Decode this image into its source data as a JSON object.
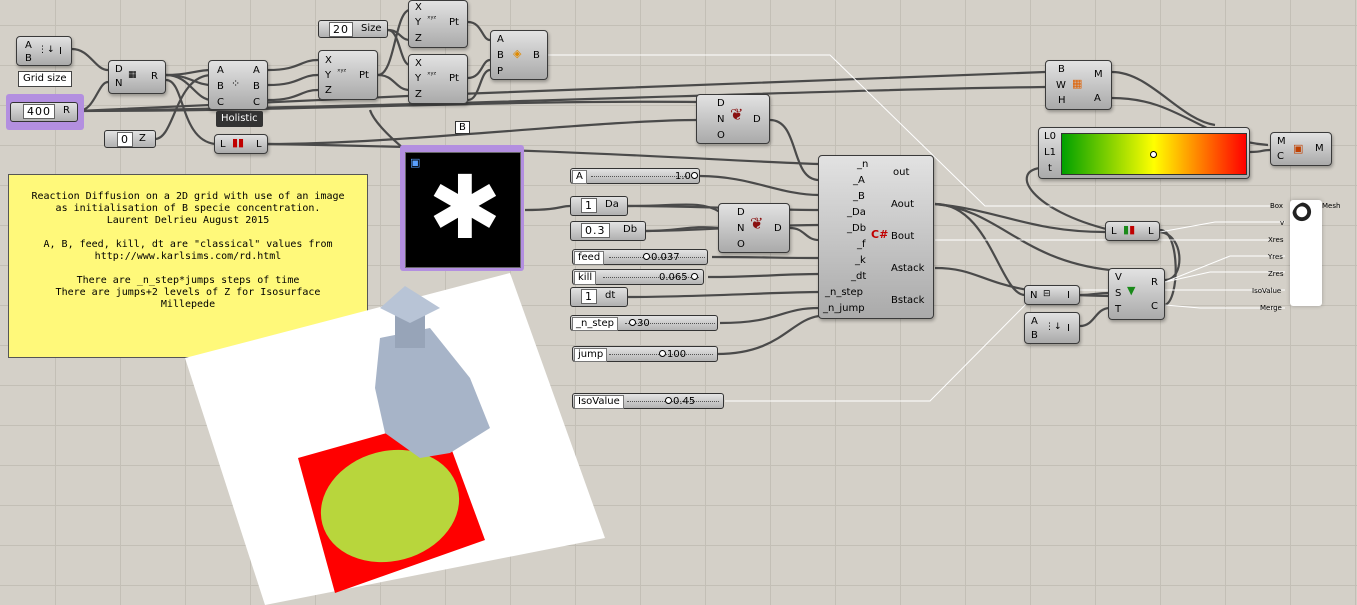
{
  "canvas": {
    "background": "#d4d0c8"
  },
  "note": {
    "text": "Reaction Diffusion on a 2D grid with use of an image\nas initialisation of B specie concentration.\nLaurent Delrieu August 2015\n\nA, B, feed, kill, dt are \"classical\" values from\nhttp://www.karlsims.com/rd.html\n\nThere are _n_step*jumps steps of time\nThere are jumps+2 levels of Z for Isosurface\nMillepede"
  },
  "tooltips": {
    "grid_size": "Grid size",
    "holistic": "Holistic",
    "b_tag": "B"
  },
  "series_comp": {
    "in_a": "A",
    "in_b": "B",
    "out": "I"
  },
  "grid_size_panel": {
    "value": "400",
    "out": "R"
  },
  "domain_comp": {
    "in_d": "D",
    "in_n": "N",
    "out": "R"
  },
  "deconstruct_domain": {
    "ins": [
      "A",
      "B",
      "C"
    ],
    "outs": [
      "A",
      "B",
      "C"
    ]
  },
  "z_panel": {
    "value": "0",
    "out": "Z"
  },
  "list_length": {
    "in": "L",
    "out": "L"
  },
  "size_panel": {
    "value": "20",
    "out": "Size"
  },
  "construct_point_1": {
    "ins": [
      "X",
      "Y",
      "Z"
    ],
    "out": "Pt"
  },
  "construct_point_2": {
    "ins": [
      "X",
      "Y",
      "Z"
    ],
    "out": "Pt"
  },
  "construct_point_3": {
    "ins": [
      "X",
      "Y",
      "Z"
    ],
    "out": "Pt"
  },
  "box_comp": {
    "ins": [
      "A",
      "B",
      "P"
    ],
    "out": "B"
  },
  "rect_comp": {
    "ins": [
      "B",
      "W",
      "H"
    ],
    "outs": [
      "M",
      "A"
    ]
  },
  "image_sampler_1": {
    "ins": [
      "D",
      "N",
      "O"
    ],
    "out": "D"
  },
  "image_sampler_2": {
    "ins": [
      "D",
      "N",
      "O"
    ],
    "out": "D"
  },
  "gradient": {
    "ins": [
      "L0",
      "L1",
      "t"
    ]
  },
  "mesh_color": {
    "ins": [
      "M",
      "C"
    ],
    "out": "M"
  },
  "csharp": {
    "ins": [
      "_n",
      "_A",
      "_B",
      "_Da",
      "_Db",
      "_f",
      "_k",
      "_dt",
      "_n_step",
      "_n_jump"
    ],
    "outs": [
      "out",
      "Aout",
      "Bout",
      "Astack",
      "Bstack"
    ]
  },
  "sliders": [
    {
      "name": "A",
      "value": "1.0",
      "fraction": 1.0
    },
    {
      "name": "feed",
      "value": "0.037",
      "fraction": 0.45
    },
    {
      "name": "kill",
      "value": "0.065",
      "fraction": 0.55
    },
    {
      "name": "_n_step",
      "value": "30",
      "fraction": 0.05
    },
    {
      "name": "jump",
      "value": "100",
      "fraction": 0.55
    },
    {
      "name": "IsoValue",
      "value": "0.45",
      "fraction": 0.45
    }
  ],
  "da_panel": {
    "value": "1",
    "out": "Da"
  },
  "db_panel": {
    "value": "0.3",
    "out": "Db"
  },
  "dt_panel": {
    "value": "1",
    "out": "dt"
  },
  "list_item": {
    "in": "L",
    "out": "L"
  },
  "bounds_comp": {
    "in": "N",
    "out": "I"
  },
  "series_comp_2": {
    "ins": [
      "A",
      "B"
    ],
    "out": "I"
  },
  "sub_list": {
    "ins": [
      "V",
      "S",
      "T"
    ],
    "outs": [
      "R",
      "C"
    ]
  },
  "millipede": {
    "inputs": [
      "Box",
      "v",
      "Xres",
      "Yres",
      "Zres",
      "IsoValue",
      "Merge"
    ],
    "output": "Mesh"
  },
  "colors": {
    "wire": "#4a4a4a",
    "wire_selected": "#ffffff",
    "note": "#fff97a",
    "selection": "#b38fe0",
    "gradient": [
      "#00a000",
      "#ffff00",
      "#ff0000"
    ]
  }
}
